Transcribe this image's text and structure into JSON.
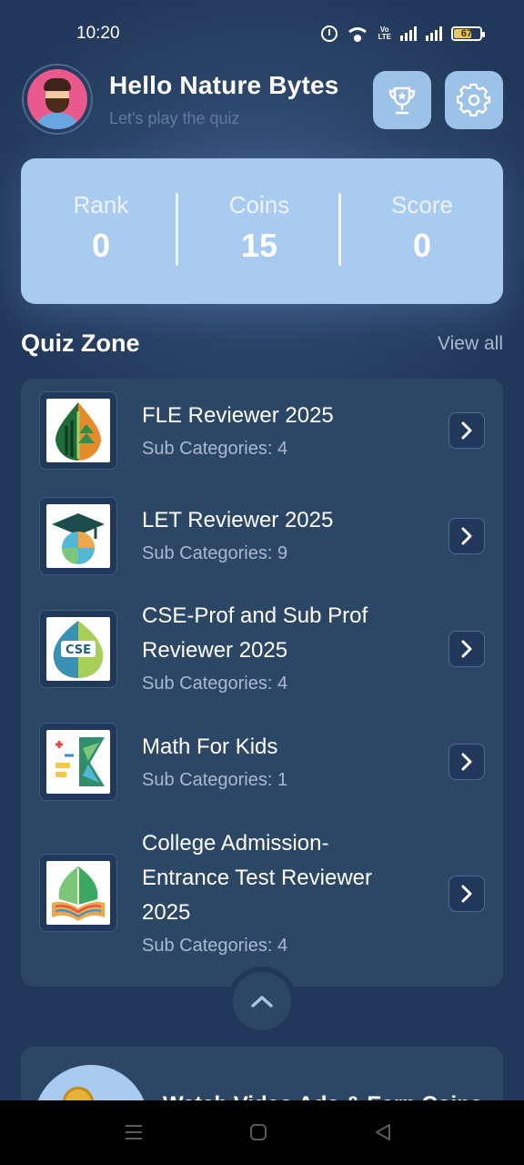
{
  "status_bar": {
    "time": "10:20",
    "volte_label": "Vo LTE",
    "battery_percent": "67",
    "battery_level": 0.67,
    "icons": [
      "alarm-icon",
      "wifi-icon",
      "volte-icon",
      "signal-icon",
      "signal-icon",
      "battery-icon"
    ]
  },
  "header": {
    "greeting": "Hello Nature Bytes",
    "subtitle": "Let's play the quiz",
    "avatar_icon": "avatar-icon",
    "trophy_icon": "trophy-icon",
    "settings_icon": "gear-icon"
  },
  "stats": {
    "rank_label": "Rank",
    "rank_value": "0",
    "coins_label": "Coins",
    "coins_value": "15",
    "score_label": "Score",
    "score_value": "0"
  },
  "quiz_zone": {
    "title": "Quiz Zone",
    "view_all": "View all",
    "items": [
      {
        "title": "FLE Reviewer 2025",
        "sub": "Sub Categories: 4",
        "icon": "forest-leaf-icon"
      },
      {
        "title": "LET Reviewer 2025",
        "sub": "Sub Categories: 9",
        "icon": "graduation-cap-icon"
      },
      {
        "title_line1": "CSE-Prof and Sub Prof",
        "title_line2": "Reviewer 2025",
        "sub": "Sub Categories: 4",
        "icon": "cse-leaf-icon",
        "badge": "CSE"
      },
      {
        "title": "Math For Kids",
        "sub": "Sub Categories: 1",
        "icon": "math-icon"
      },
      {
        "title_line1": "College Admission-",
        "title_line2": "Entrance Test Reviewer",
        "title_line3": "2025",
        "sub": "Sub Categories: 4",
        "icon": "open-book-leaf-icon"
      }
    ]
  },
  "promo": {
    "text": "Watch Video Ads & Earn Coins",
    "icon": "coin-icon"
  },
  "colors": {
    "background": "#22385a",
    "card": "#2c4666",
    "stats_card": "#a8cbef",
    "icon_button": "#9dc2e8",
    "muted_text": "#a9b9cf"
  }
}
